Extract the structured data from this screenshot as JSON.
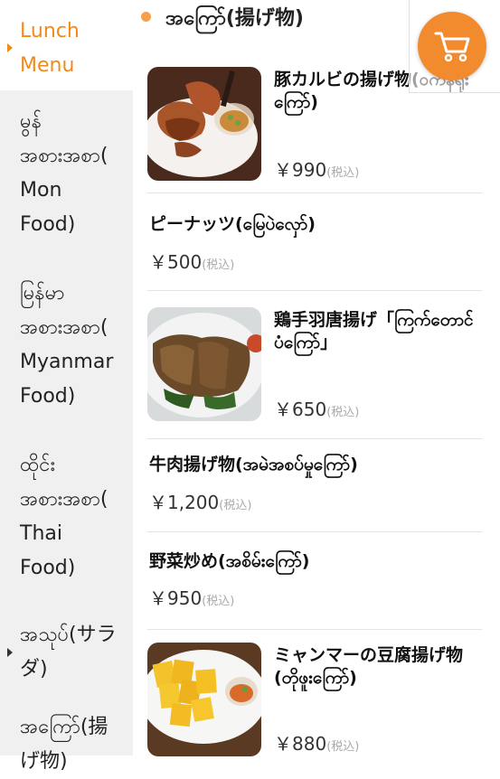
{
  "sidebar": {
    "items": [
      {
        "label": "Lunch\nMenu",
        "active": true
      },
      {
        "label": "မွန်\nအစားအစာ(\nMon\nFood)"
      },
      {
        "label": "မြန်မာ\nအစားအစာ(\nMyanmar\nFood)"
      },
      {
        "label": "ထိုင်း\nအစားအစာ(\nThai\nFood)"
      },
      {
        "label": "အသုပ်(サラ\nダ)"
      },
      {
        "label": "အကြော်(揚\nげ物)"
      }
    ]
  },
  "category": {
    "title": "အကြော်(揚げ物)"
  },
  "menu": [
    {
      "name": "豚カルビの揚げ物(ဝက်နံရိုးကြော်)",
      "price": "￥990",
      "tax": "(税込)",
      "image": "fried-pork-photo"
    },
    {
      "name": "ピーナッツ(မြေပဲလှော်)",
      "price": "￥500",
      "tax": "(税込)"
    },
    {
      "name": "鶏手羽唐揚げ「ကြက်တောင်ပံကြော်」",
      "price": "￥650",
      "tax": "(税込)",
      "image": "chicken-wings-photo"
    },
    {
      "name": "牛肉揚げ物(အမဲအစပ်မှုကြော်)",
      "price": "￥1,200",
      "tax": "(税込)"
    },
    {
      "name": "野菜炒め(အစိမ်းကြော်)",
      "price": "￥950",
      "tax": "(税込)"
    },
    {
      "name": "ミャンマーの豆腐揚げ物(တိုဖူးကြော်)",
      "price": "￥880",
      "tax": "(税込)",
      "image": "fried-tofu-photo"
    }
  ],
  "cart": {
    "icon": "cart-icon"
  },
  "colors": {
    "accent": "#f08a1c",
    "cart": "#f28a2e"
  }
}
